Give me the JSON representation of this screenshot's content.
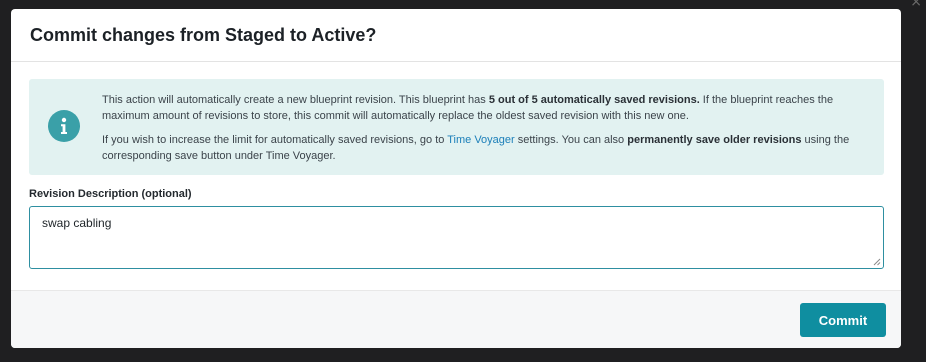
{
  "dialog": {
    "title": "Commit changes from Staged to Active?",
    "info": {
      "icon": "info-icon",
      "para1_a": "This action will automatically create a new blueprint revision. This blueprint has ",
      "para1_count": "5 out of",
      "para1_b": " ",
      "para1_bold": "5 automatically saved revisions.",
      "para1_c": " If the blueprint reaches the maximum amount of revisions to store, this commit will automatically replace the oldest saved revision with this new one.",
      "para2_a": "If you wish to increase the limit for automatically saved revisions, go to ",
      "para2_link": "Time Voyager",
      "para2_b": " settings. You can also ",
      "para2_bold": "permanently save older revisions",
      "para2_c": " using the corresponding save button under Time Voyager."
    },
    "revision": {
      "label": "Revision Description (optional)",
      "value": "swap cabling"
    },
    "commit_label": "Commit"
  },
  "colors": {
    "accent": "#0f8ea0",
    "info_bg": "#e2f2f1",
    "info_icon": "#3aa0a8",
    "link": "#1b7fb9"
  }
}
